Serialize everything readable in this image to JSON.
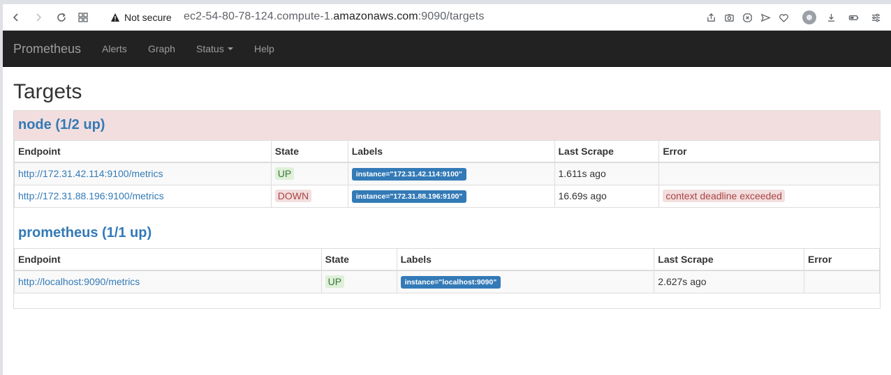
{
  "browser": {
    "security_text": "Not secure",
    "url_prefix": "ec2-54-80-78-124.compute-1.",
    "url_host": "amazonaws.com",
    "url_suffix": ":9090/targets"
  },
  "navbar": {
    "brand": "Prometheus",
    "links": [
      "Alerts",
      "Graph",
      "Status",
      "Help"
    ]
  },
  "page": {
    "title": "Targets"
  },
  "jobs": [
    {
      "title": "node (1/2 up)",
      "health": "down",
      "columns": [
        "Endpoint",
        "State",
        "Labels",
        "Last Scrape",
        "Error"
      ],
      "rows": [
        {
          "endpoint": "http://172.31.42.114:9100/metrics",
          "state": "UP",
          "labels": "instance=\"172.31.42.114:9100\"",
          "last_scrape": "1.611s ago",
          "error": ""
        },
        {
          "endpoint": "http://172.31.88.196:9100/metrics",
          "state": "DOWN",
          "labels": "instance=\"172.31.88.196:9100\"",
          "last_scrape": "16.69s ago",
          "error": "context deadline exceeded"
        }
      ]
    },
    {
      "title": "prometheus (1/1 up)",
      "health": "up",
      "columns": [
        "Endpoint",
        "State",
        "Labels",
        "Last Scrape",
        "Error"
      ],
      "rows": [
        {
          "endpoint": "http://localhost:9090/metrics",
          "state": "UP",
          "labels": "instance=\"localhost:9090\"",
          "last_scrape": "2.627s ago",
          "error": ""
        }
      ]
    }
  ]
}
